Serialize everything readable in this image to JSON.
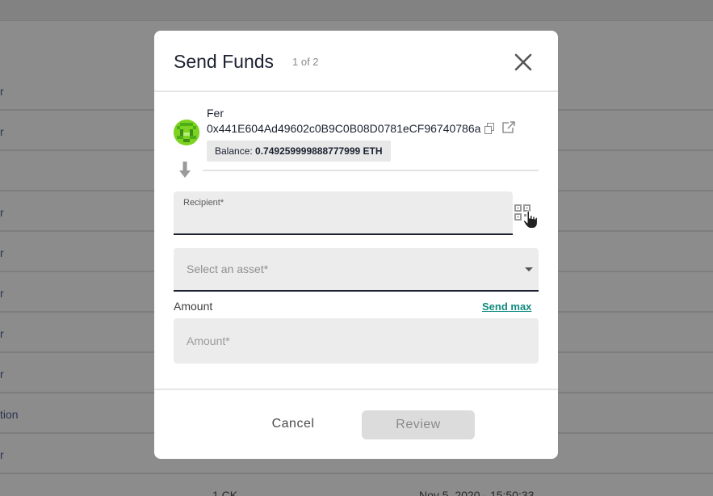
{
  "background": {
    "rows": [
      {
        "c1": "r",
        "c2": "",
        "c3": ""
      },
      {
        "c1": "r",
        "c2": "",
        "c3": ""
      },
      {
        "c1": "",
        "c2": "",
        "c3": ""
      },
      {
        "c1": "r",
        "c2": "",
        "c3": ""
      },
      {
        "c1": "r",
        "c2": "",
        "c3": ""
      },
      {
        "c1": "r",
        "c2": "",
        "c3": ""
      },
      {
        "c1": "r",
        "c2": "",
        "c3": ""
      },
      {
        "c1": "r",
        "c2": "",
        "c3": ""
      },
      {
        "c1": "tion",
        "c2": "",
        "c3": ""
      },
      {
        "c1": "r",
        "c2": "",
        "c3": ""
      },
      {
        "c1": "",
        "c2": "1 CK",
        "c3": "Nov 5, 2020 - 15:50:33"
      }
    ]
  },
  "modal": {
    "title": "Send Funds",
    "step": "1 of 2",
    "close_icon": "close-icon"
  },
  "sender": {
    "name": "Fer",
    "address": "0x441E604Ad49602c0B9C0B08D0781eCF96740786a",
    "balance_label": "Balance:",
    "balance_value": "0.749259999888777999 ETH"
  },
  "form": {
    "recipient_label": "Recipient*",
    "recipient_value": "",
    "asset_placeholder": "Select an asset*",
    "amount_label": "Amount",
    "send_max": "Send max",
    "amount_placeholder": "Amount*"
  },
  "footer": {
    "cancel": "Cancel",
    "review": "Review"
  },
  "colors": {
    "accent": "#108a80",
    "avatar": "#7ed321",
    "input_underline": "#1b2130"
  }
}
